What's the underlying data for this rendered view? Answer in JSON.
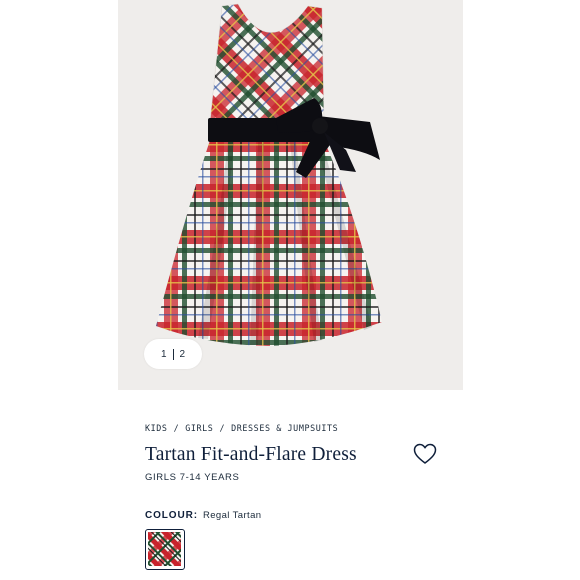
{
  "gallery": {
    "pager": {
      "current": "1",
      "total": "2"
    },
    "image_alt": "Tartan Fit-and-Flare Dress"
  },
  "breadcrumb": [
    "KIDS",
    "GIRLS",
    "DRESSES & JUMPSUITS"
  ],
  "product": {
    "title": "Tartan Fit-and-Flare Dress",
    "subtitle": "GIRLS 7-14 YEARS"
  },
  "colour": {
    "label": "COLOUR:",
    "value": "Regal Tartan"
  },
  "icons": {
    "wishlist": "heart-icon",
    "swatch": "tartan-swatch"
  },
  "colors": {
    "navy": "#0f1f3a",
    "gallery_bg": "#efedeb",
    "tartan_red": "#c8232c",
    "tartan_green": "#1f4d2e",
    "bow": "#0d0d12"
  }
}
